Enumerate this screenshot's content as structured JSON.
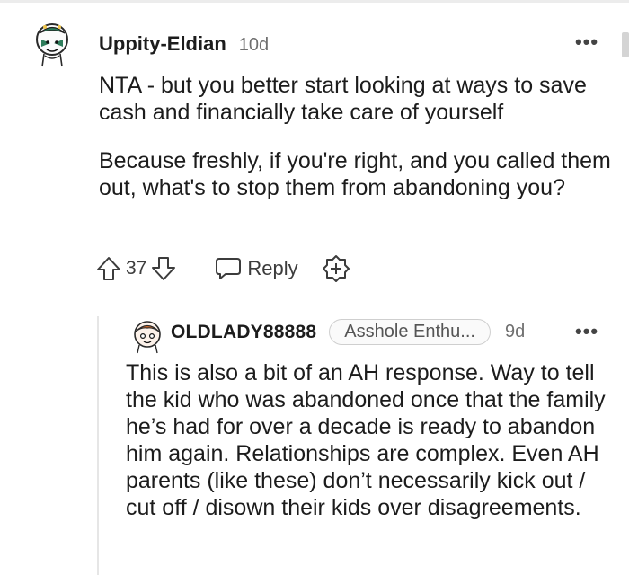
{
  "comment": {
    "username": "Uppity-Eldian",
    "age": "10d",
    "paragraphs": [
      "NTA - but you better start looking at ways to save cash and financially take care of yourself",
      "Because freshly, if you're right, and you called them out, what's to stop them from abandoning you?"
    ],
    "votes": "37",
    "reply_label": "Reply",
    "more_label": "•••"
  },
  "reply": {
    "username": "OLDLADY88888",
    "flair": "Asshole Enthu...",
    "age": "9d",
    "more_label": "•••",
    "text": "This is also a bit of an AH response. Way to tell the kid who was abandoned once that the family he’s had for over a decade is ready to abandon him again. Relationships are complex. Even AH parents (like these) don’t necessarily kick out / cut off / disown their kids over disagreements."
  },
  "colors": {
    "text": "#1c1c1c",
    "muted": "#6f6f6f",
    "avatar_green": "#2e7d5b",
    "avatar_orange": "#e8742a"
  },
  "icons": [
    "user-avatar",
    "upvote-arrow",
    "downvote-arrow",
    "speech-bubble",
    "award-plus",
    "more-dots"
  ]
}
